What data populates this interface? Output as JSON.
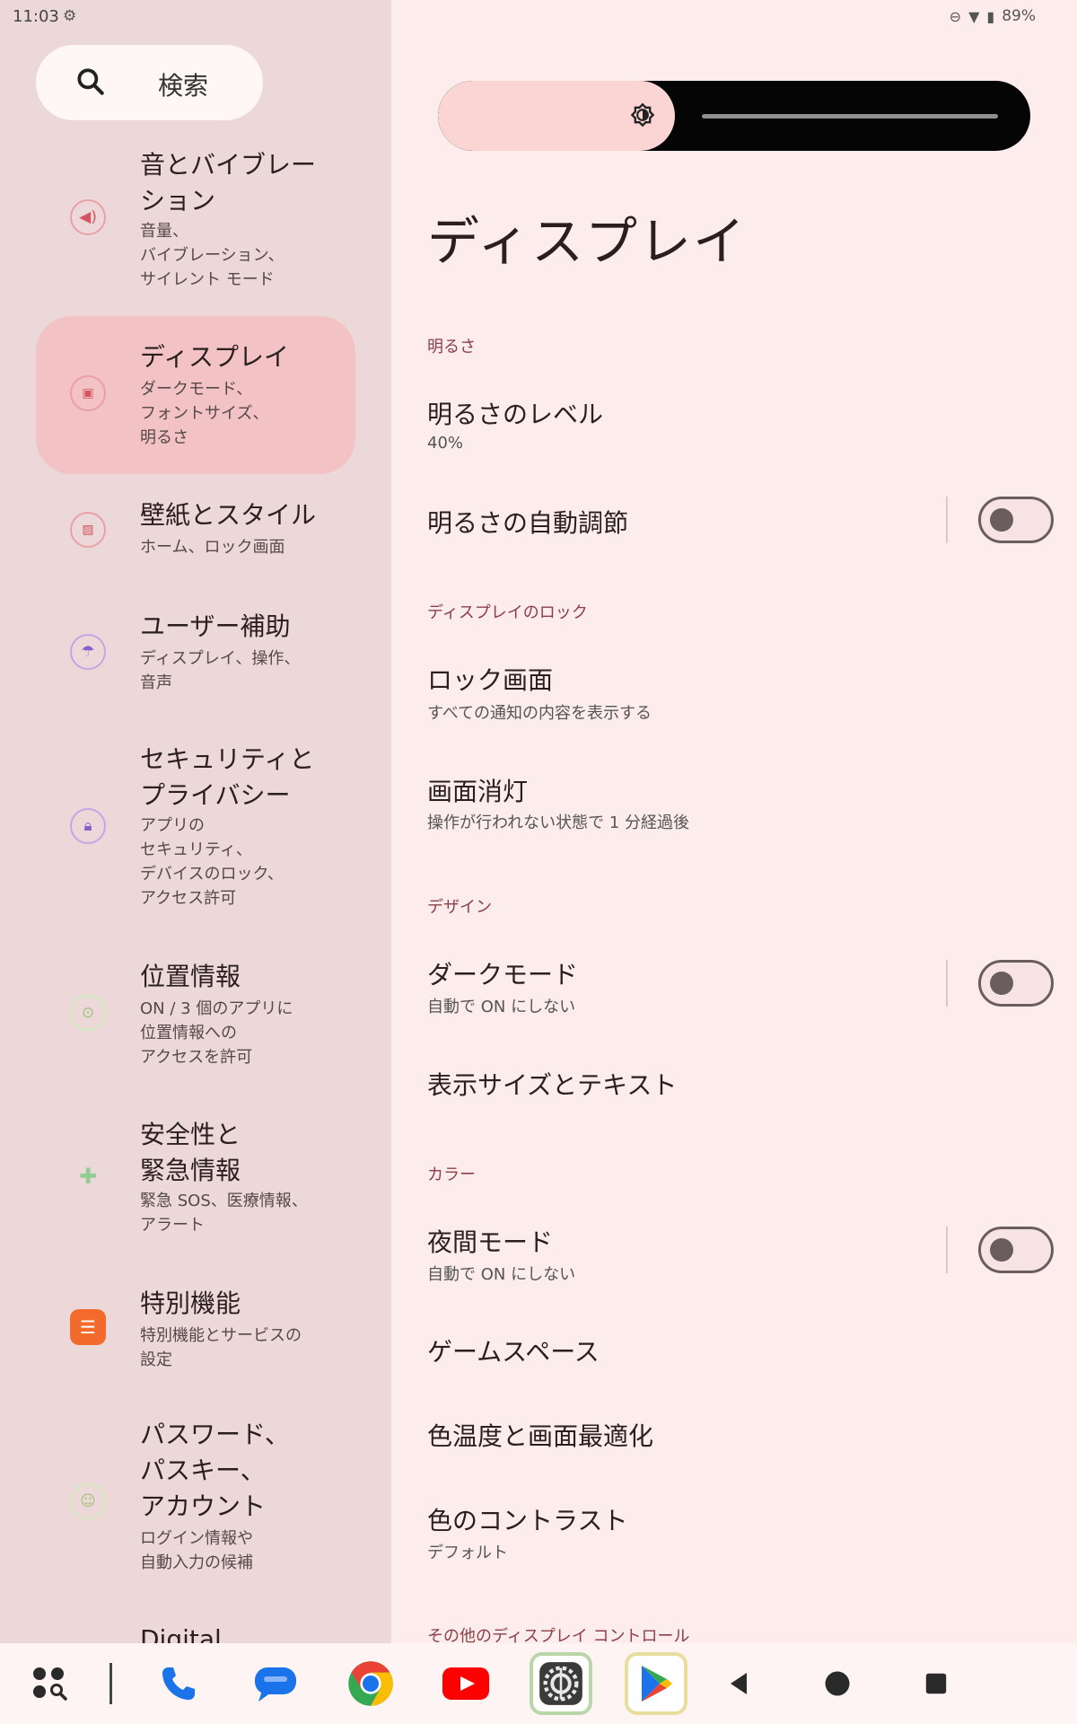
{
  "status_bar": {
    "time": "11:03",
    "battery": "89%"
  },
  "sidebar": {
    "search_label": "検索",
    "items": [
      {
        "title": "音とバイブレー\nション",
        "sub": "音量、\nバイブレーション、\nサイレント モード",
        "icon": "speaker-icon"
      },
      {
        "title": "ディスプレイ",
        "sub": "ダークモード、\nフォントサイズ、\n明るさ",
        "icon": "display-icon"
      },
      {
        "title": "壁紙とスタイル",
        "sub": "ホーム、ロック画面",
        "icon": "wallpaper-icon"
      },
      {
        "title": "ユーザー補助",
        "sub": "ディスプレイ、操作、\n音声",
        "icon": "accessibility-icon"
      },
      {
        "title": "セキュリティと\nプライバシー",
        "sub": "アプリの\nセキュリティ、\nデバイスのロック、\nアクセス許可",
        "icon": "lock-icon"
      },
      {
        "title": "位置情報",
        "sub": "ON / 3 個のアプリに\n位置情報への\nアクセスを許可",
        "icon": "location-icon"
      },
      {
        "title": "安全性と\n緊急情報",
        "sub": "緊急 SOS、医療情報、\nアラート",
        "icon": "emergency-icon"
      },
      {
        "title": "特別機能",
        "sub": "特別機能とサービスの\n設定",
        "icon": "special-features-icon"
      },
      {
        "title": "パスワード、\nパスキー、\nアカウント",
        "sub": "ログイン情報や\n自動入力の候補",
        "icon": "key-icon"
      },
      {
        "title": "Digital",
        "sub": "",
        "icon": ""
      }
    ]
  },
  "content": {
    "brightness_percent": 40,
    "page_title": "ディスプレイ",
    "sections": {
      "brightness": "明るさ",
      "lock": "ディスプレイのロック",
      "design": "デザイン",
      "color": "カラー",
      "other": "その他のディスプレイ コントロール"
    },
    "rows": {
      "brightness_level": {
        "title": "明るさのレベル",
        "sub": "40%"
      },
      "adaptive": {
        "title": "明るさの自動調節"
      },
      "lock_screen": {
        "title": "ロック画面",
        "sub": "すべての通知の内容を表示する"
      },
      "screen_timeout": {
        "title": "画面消灯",
        "sub": "操作が行われない状態で 1 分経過後"
      },
      "dark_mode": {
        "title": "ダークモード",
        "sub": "自動で ON にしない"
      },
      "display_size": {
        "title": "表示サイズとテキスト"
      },
      "night_mode": {
        "title": "夜間モード",
        "sub": "自動で ON にしない"
      },
      "game_space": {
        "title": "ゲームスペース"
      },
      "color_temp": {
        "title": "色温度と画面最適化"
      },
      "contrast": {
        "title": "色のコントラスト",
        "sub": "デフォルト"
      }
    },
    "toggles": {
      "adaptive": false,
      "dark_mode": false,
      "night_mode": false
    }
  },
  "colors": {
    "accent": "#8c3f45",
    "selected_bg": "#f3c2c4",
    "sidebar_bg": "#ecd8d8",
    "content_bg": "#fdecec"
  }
}
